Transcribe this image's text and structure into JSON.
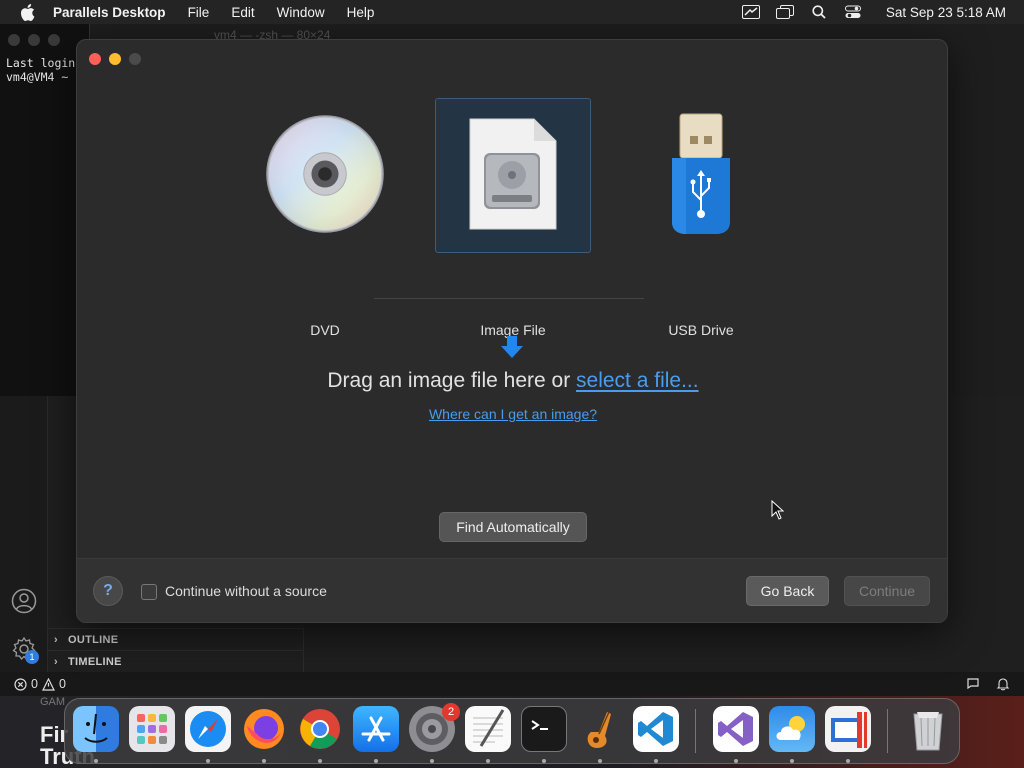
{
  "menubar": {
    "app_name": "Parallels Desktop",
    "items": [
      "File",
      "Edit",
      "Window",
      "Help"
    ],
    "clock": "Sat Sep 23  5:18 AM"
  },
  "background": {
    "terminal_lines": "Last login\nvm4@VM4 ~",
    "window_title": "vm4 — -zsh — 80×24",
    "outline_label": "OUTLINE",
    "timeline_label": "TIMELINE",
    "status_errors": "0",
    "status_warnings": "0",
    "settings_badge": "1",
    "wallpaper_game": "GAM",
    "wallpaper_text": "Fir Truth in"
  },
  "dialog": {
    "sources": [
      {
        "label": "DVD",
        "icon": "dvd-icon"
      },
      {
        "label": "Image File",
        "icon": "image-file-icon",
        "selected": true
      },
      {
        "label": "USB Drive",
        "icon": "usb-drive-icon"
      }
    ],
    "drag_text": "Drag an image file here or ",
    "select_link": "select a file...",
    "where_link": "Where can I get an image?",
    "find_button": "Find Automatically",
    "help_button": "?",
    "continue_without_label": "Continue without a source",
    "continue_without_checked": false,
    "back_button": "Go Back",
    "continue_button": "Continue",
    "continue_enabled": false
  },
  "dock": {
    "apps": [
      "Finder",
      "Launchpad",
      "Safari",
      "Firefox",
      "Chrome",
      "App Store",
      "System Settings",
      "TextEdit",
      "Terminal",
      "GarageBand",
      "Visual Studio Code",
      "Visual Studio",
      "Weather",
      "Parallels Desktop",
      "Trash"
    ],
    "settings_badge": "2"
  },
  "colors": {
    "accent_link": "#4a9cf0",
    "selected_bg": "#233444",
    "close": "#ff5f57",
    "minimize": "#febc2e"
  }
}
